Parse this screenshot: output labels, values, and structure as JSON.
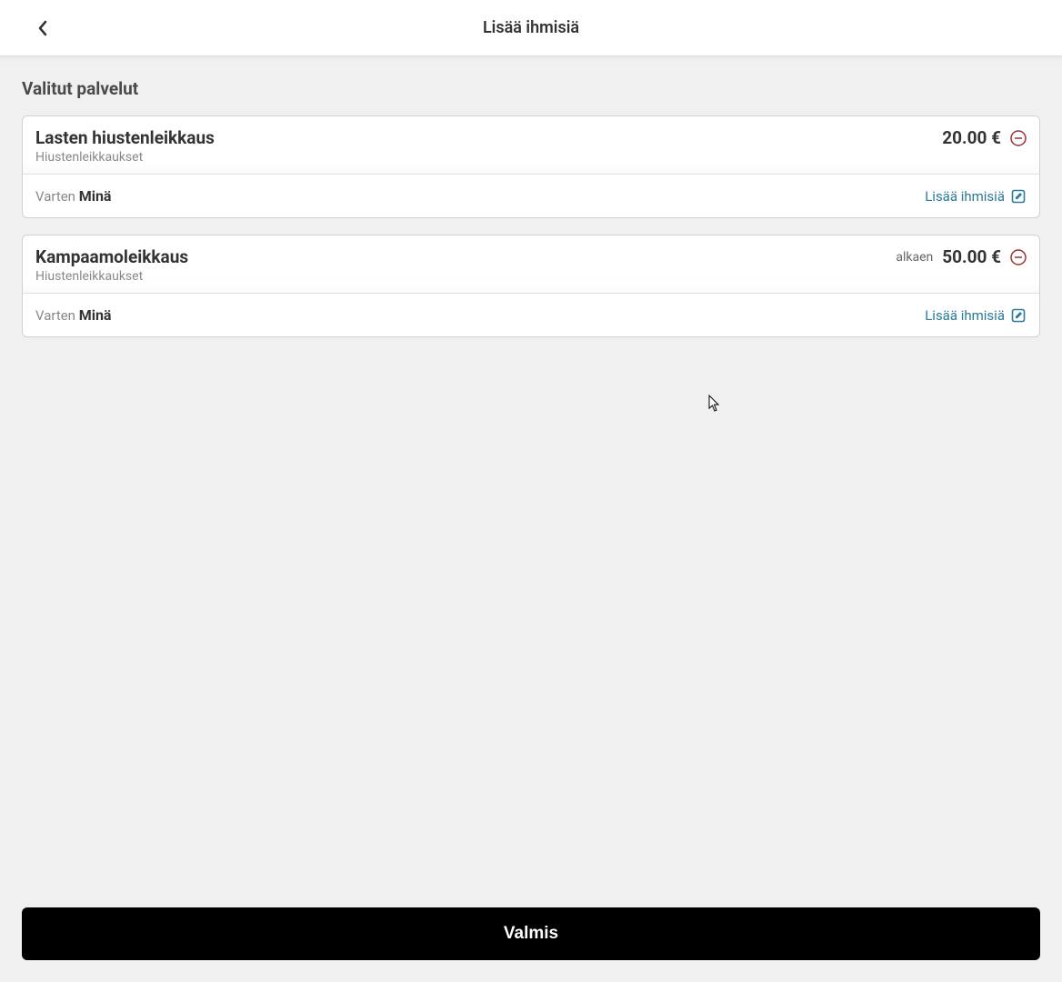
{
  "header": {
    "title": "Lisää ihmisiä"
  },
  "section_title": "Valitut palvelut",
  "services": [
    {
      "name": "Lasten hiustenleikkaus",
      "category": "Hiustenleikkaukset",
      "price_prefix": "",
      "price": "20.00 €",
      "for_label": "Varten ",
      "for_name": "Minä",
      "add_people_label": "Lisää ihmisiä"
    },
    {
      "name": "Kampaamoleikkaus",
      "category": "Hiustenleikkaukset",
      "price_prefix": "alkaen",
      "price": "50.00 €",
      "for_label": "Varten ",
      "for_name": "Minä",
      "add_people_label": "Lisää ihmisiä"
    }
  ],
  "footer": {
    "done_label": "Valmis"
  }
}
